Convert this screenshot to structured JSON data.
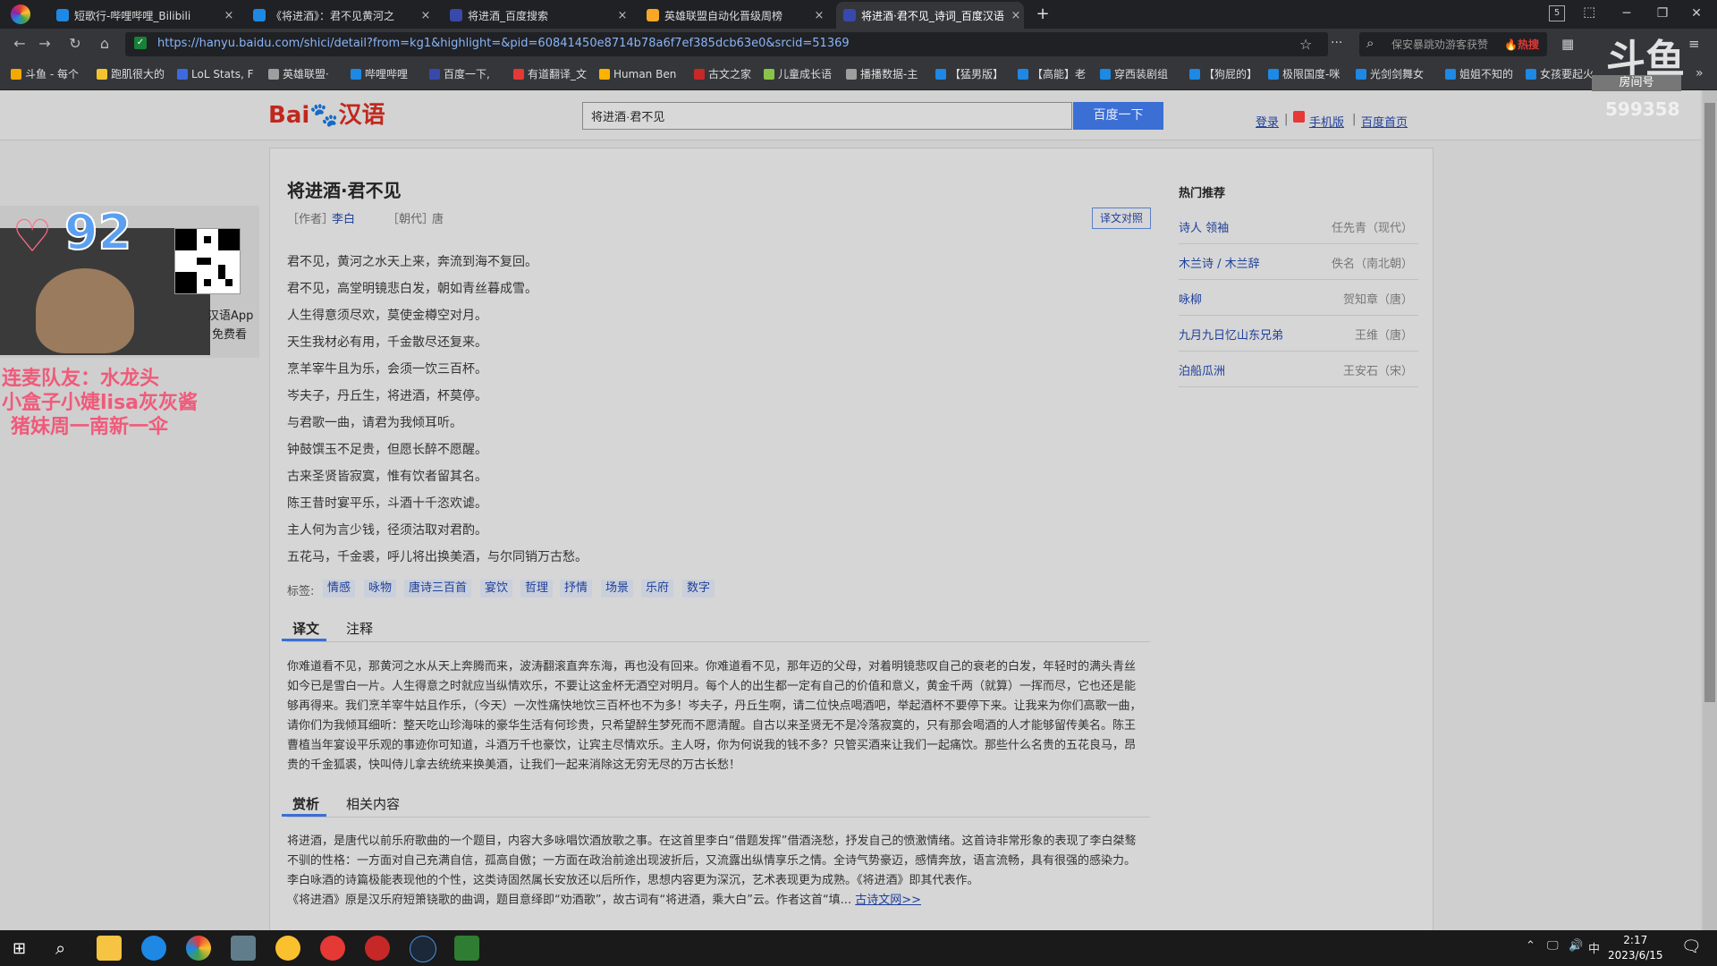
{
  "browser": {
    "tabs": [
      {
        "label": "短歌行-哔哩哔哩_Bilibili",
        "color": "#1e88e5"
      },
      {
        "label": "《将进酒》：君不见黄河之",
        "color": "#1e88e5"
      },
      {
        "label": "将进酒_百度搜索",
        "color": "#3949ab"
      },
      {
        "label": "英雄联盟自动化晋级周榜",
        "color": "#f9a825"
      },
      {
        "label": "将进酒·君不见_诗词_百度汉语",
        "color": "#3949ab"
      }
    ],
    "new_tab": "+",
    "tab_close": "×",
    "url": "https://hanyu.baidu.com/shici/detail?from=kg1&highlight=&pid=60841450e8714b78a6f7ef385dcb63e0&srcid=51369",
    "search_placeholder": "保安暴跳劝游客获赞",
    "search_hot": "🔥热搜",
    "tab_count": "5",
    "bookmarks": [
      {
        "label": "斗鱼 - 每个",
        "color": "#f4a900"
      },
      {
        "label": "跑肌很大的",
        "color": "#f4c430"
      },
      {
        "label": "LoL Stats, F",
        "color": "#3d6adf"
      },
      {
        "label": "英雄联盟·",
        "color": "#9e9e9e"
      },
      {
        "label": "哔哩哔哩",
        "color": "#1e88e5"
      },
      {
        "label": "百度一下,",
        "color": "#3949ab"
      },
      {
        "label": "有道翻译_文",
        "color": "#e53935"
      },
      {
        "label": "Human Ben",
        "color": "#ffb300"
      },
      {
        "label": "古文之家",
        "color": "#c62828"
      },
      {
        "label": "儿童成长语",
        "color": "#8bc34a"
      },
      {
        "label": "播播数据-主",
        "color": "#9e9e9e"
      },
      {
        "label": "【猛男版】",
        "color": "#1e88e5"
      },
      {
        "label": "【高能】老",
        "color": "#1e88e5"
      },
      {
        "label": "穿西装剧组",
        "color": "#1e88e5"
      },
      {
        "label": "【狗屁的】",
        "color": "#1e88e5"
      },
      {
        "label": "极限国度-咪",
        "color": "#1e88e5"
      },
      {
        "label": "光剑剑舞女",
        "color": "#1e88e5"
      },
      {
        "label": "姐姐不知的",
        "color": "#1e88e5"
      },
      {
        "label": "女孩要起火",
        "color": "#1e88e5"
      }
    ],
    "more_bookmarks": "»"
  },
  "page": {
    "search_value": "将进酒·君不见",
    "search_button": "百度一下",
    "links": {
      "login": "登录",
      "mobile": "手机版",
      "home": "百度首页"
    },
    "title": "将进酒·君不见",
    "author_label": "［作者］",
    "author": "李白",
    "dynasty_label": "［朝代］",
    "dynasty": "唐",
    "compare_button": "译文对照",
    "poem": [
      "君不见，黄河之水天上来，奔流到海不复回。",
      "君不见，高堂明镜悲白发，朝如青丝暮成雪。",
      "人生得意须尽欢，莫使金樽空对月。",
      "天生我材必有用，千金散尽还复来。",
      "烹羊宰牛且为乐，会须一饮三百杯。",
      "岑夫子，丹丘生，将进酒，杯莫停。",
      "与君歌一曲，请君为我倾耳听。",
      "钟鼓馔玉不足贵，但愿长醉不愿醒。",
      "古来圣贤皆寂寞，惟有饮者留其名。",
      "陈王昔时宴平乐，斗酒十千恣欢谑。",
      "主人何为言少钱，径须沽取对君酌。",
      "五花马，千金裘，呼儿将出换美酒，与尔同销万古愁。"
    ],
    "tags_label": "标签:",
    "tags": [
      "情感",
      "咏物",
      "唐诗三百首",
      "宴饮",
      "哲理",
      "抒情",
      "场景",
      "乐府",
      "数字"
    ],
    "tabs1": [
      "译文",
      "注释"
    ],
    "translation": "你难道看不见，那黄河之水从天上奔腾而来，波涛翻滚直奔东海，再也没有回来。你难道看不见，那年迈的父母，对着明镜悲叹自己的衰老的白发，年轻时的满头青丝如今已是雪白一片。人生得意之时就应当纵情欢乐，不要让这金杯无酒空对明月。每个人的出生都一定有自己的价值和意义，黄金千两（就算）一挥而尽，它也还是能够再得来。我们烹羊宰牛姑且作乐，（今天）一次性痛快地饮三百杯也不为多！岑夫子，丹丘生啊，请二位快点喝酒吧，举起酒杯不要停下来。让我来为你们高歌一曲，请你们为我倾耳细听：整天吃山珍海味的豪华生活有何珍贵，只希望醉生梦死而不愿清醒。自古以来圣贤无不是冷落寂寞的，只有那会喝酒的人才能够留传美名。陈王曹植当年宴设平乐观的事迹你可知道，斗酒万千也豪饮，让宾主尽情欢乐。主人呀，你为何说我的钱不多？只管买酒来让我们一起痛饮。那些什么名贵的五花良马，昂贵的千金狐裘，快叫侍儿拿去统统来换美酒，让我们一起来消除这无穷无尽的万古长愁！",
    "tabs2": [
      "赏析",
      "相关内容"
    ],
    "appreciation": "将进酒，是唐代以前乐府歌曲的一个题目，内容大多咏唱饮酒放歌之事。在这首里李白“借题发挥”借酒浇愁，抒发自己的愤激情绪。这首诗非常形象的表现了李白桀骜不驯的性格：一方面对自己充满自信，孤高自傲；一方面在政治前途出现波折后，又流露出纵情享乐之情。全诗气势豪迈，感情奔放，语言流畅，具有很强的感染力。",
    "appreciation2": "李白咏酒的诗篇极能表现他的个性，这类诗固然属长安放还以后所作，思想内容更为深沉，艺术表现更为成熟。《将进酒》即其代表作。",
    "appreciation3": "《将进酒》原是汉乐府短箫铙歌的曲调，题目意绎即“劝酒歌”，故古词有“将进酒，乘大白”云。作者这首“填...",
    "appreciation_link": "古诗文网>>",
    "sidebar_title": "热门推荐",
    "sidebar": [
      {
        "name": "诗人 领袖",
        "author": "任先青（现代）"
      },
      {
        "name": "木兰诗 / 木兰辞",
        "author": "佚名（南北朝）"
      },
      {
        "name": "咏柳",
        "author": "贺知章（唐）"
      },
      {
        "name": "九月九日忆山东兄弟",
        "author": "王维（唐）"
      },
      {
        "name": "泊船瓜洲",
        "author": "王安石（宋）"
      }
    ]
  },
  "overlay": {
    "heart_count": "92",
    "app_label": "汉语App",
    "app_free": "免费看",
    "lines": [
      "连麦队友：水龙头",
      "小盒子小婕lisa灰灰酱",
      "猪妹周一南新一伞"
    ],
    "brand": "斗鱼",
    "brand_sub": "房间号",
    "room_no": "599358"
  },
  "taskbar": {
    "time": "2:17",
    "date": "2023/6/15",
    "ime": "中"
  }
}
